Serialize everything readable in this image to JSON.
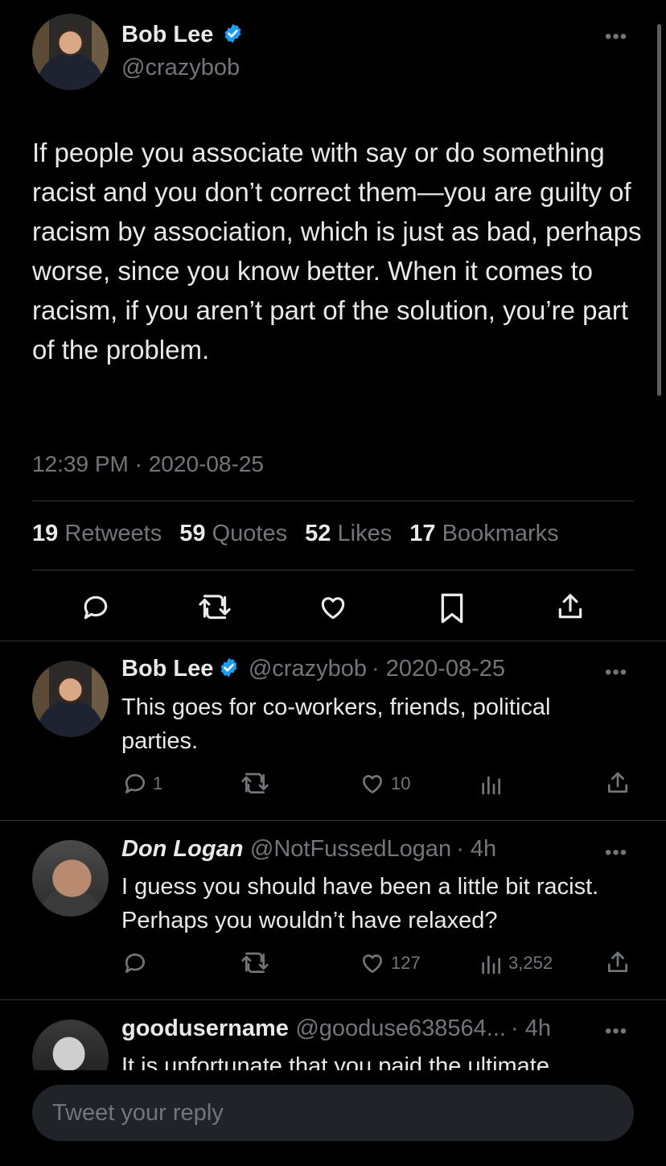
{
  "tweet": {
    "author": {
      "name": "Bob Lee",
      "handle": "@crazybob",
      "verified": true
    },
    "text": "If people you associate with say or do something racist and you don’t correct them—you are guilty of racism by association, which is just as bad, perhaps worse, since you know better. When it comes to racism, if you aren’t part of the solution, you’re part of the problem.",
    "timestamp": "12:39 PM · 2020-08-25",
    "stats": [
      {
        "count": "19",
        "label": "Retweets"
      },
      {
        "count": "59",
        "label": "Quotes"
      },
      {
        "count": "52",
        "label": "Likes"
      },
      {
        "count": "17",
        "label": "Bookmarks"
      }
    ],
    "more_label": "•••"
  },
  "replies": [
    {
      "name": "Bob Lee",
      "verified": true,
      "handle": "@crazybob",
      "time": "· 2020-08-25",
      "text": "This goes for co-workers, friends, political parties.",
      "reply_count": "1",
      "like_count": "10",
      "views": ""
    },
    {
      "name": "Don Logan",
      "verified": false,
      "handle": "@NotFussedLogan",
      "time": "· 4h",
      "text": "I guess you should have been a little bit racist. Perhaps you wouldn’t have relaxed?",
      "reply_count": "",
      "like_count": "127",
      "views": "3,252"
    },
    {
      "name": "goodusername",
      "verified": false,
      "handle": "@gooduse638564...",
      "time": "· 4h",
      "text": "It is unfortunate that you paid the ultimate"
    }
  ],
  "composer": {
    "placeholder": "Tweet your reply"
  },
  "colors": {
    "background": "#000000",
    "text": "#e7e9ea",
    "muted": "#71767b",
    "verified": "#1d9bf0"
  }
}
